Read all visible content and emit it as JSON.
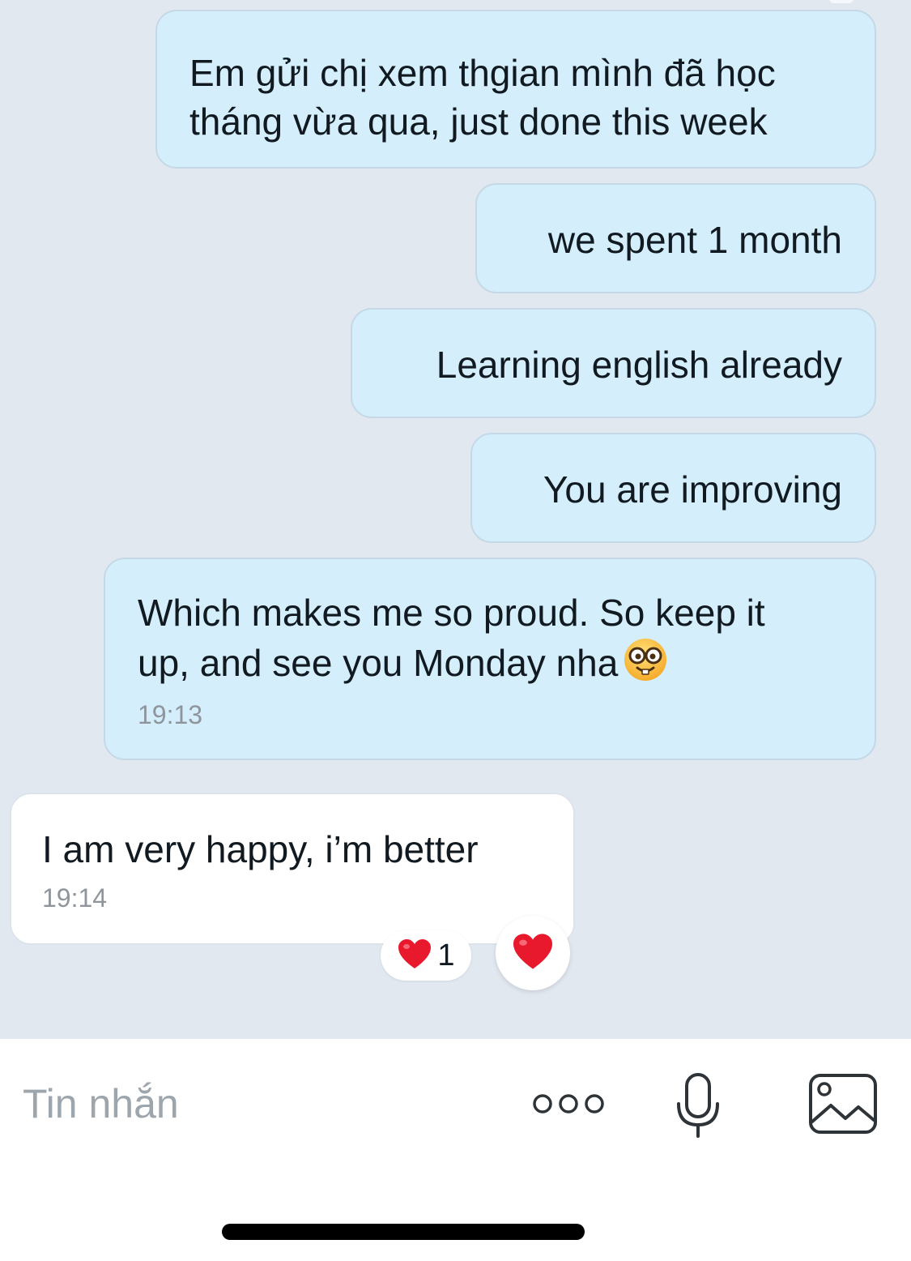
{
  "messages": [
    {
      "direction": "outgoing",
      "text": "Em gửi chị xem thgian mình đã học\ntháng vừa qua, just done this week"
    },
    {
      "direction": "outgoing",
      "text": "we spent 1 month"
    },
    {
      "direction": "outgoing",
      "text": "Learning english already"
    },
    {
      "direction": "outgoing",
      "text": "You are improving"
    },
    {
      "direction": "outgoing",
      "text": "Which makes me so proud. So keep it\nup, and see you Monday nha",
      "emoji": "nerd-face-emoji",
      "time": "19:13"
    },
    {
      "direction": "incoming",
      "text": "I am very happy, i’m better",
      "time": "19:14"
    }
  ],
  "reaction": {
    "icon": "red-heart-icon",
    "count": "1"
  },
  "composer": {
    "placeholder": "Tin nhắn",
    "icons": [
      "more-options-icon",
      "microphone-icon",
      "image-icon"
    ]
  },
  "colors": {
    "chat_background": "#e2e8f0",
    "outgoing_bubble": "#d4eefc",
    "incoming_bubble": "#ffffff",
    "heart": "#e8192c",
    "placeholder_text": "#9ea6ad"
  }
}
